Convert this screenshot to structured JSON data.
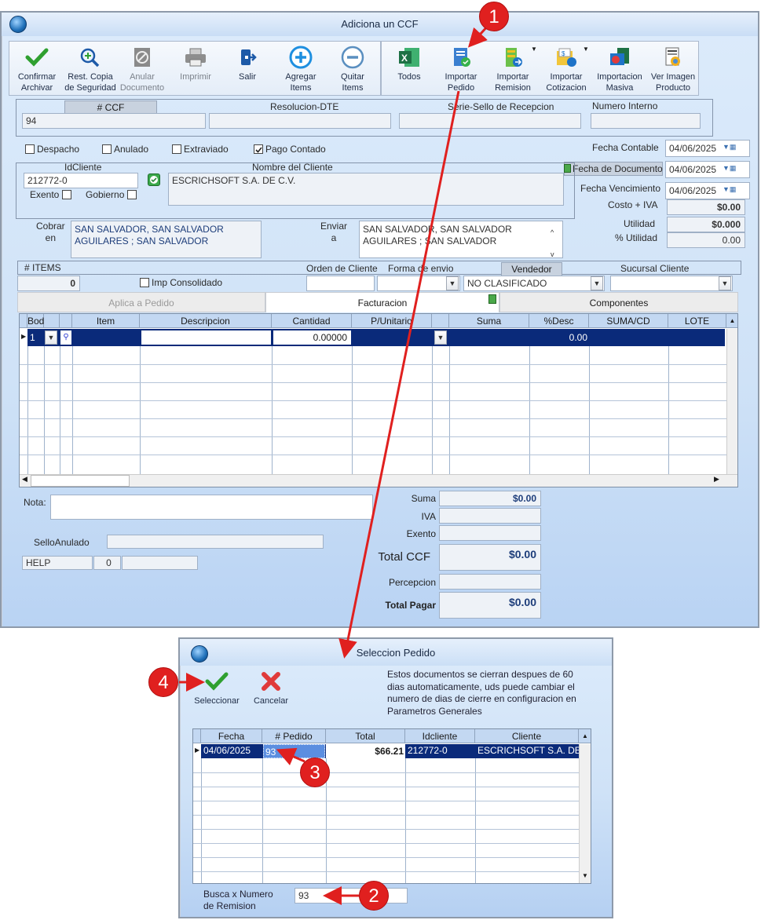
{
  "main_window": {
    "title": "Adiciona un CCF",
    "toolbar_left": [
      {
        "label": "Confirmar\nArchivar",
        "icon": "check-icon"
      },
      {
        "label": "Rest. Copia\nde Seguridad",
        "icon": "zoom-icon"
      },
      {
        "label": "Anular\nDocumento",
        "icon": "void-document-icon"
      },
      {
        "label": "Imprimir",
        "icon": "printer-icon"
      },
      {
        "label": "Salir",
        "icon": "exit-icon"
      },
      {
        "label": "Agregar\nItems",
        "icon": "plus-circle-icon"
      },
      {
        "label": "Quitar\nItems",
        "icon": "minus-circle-icon"
      }
    ],
    "toolbar_right": [
      {
        "label": "Todos",
        "icon": "excel-icon"
      },
      {
        "label": "Importar\nPedido",
        "icon": "import-order-icon"
      },
      {
        "label": "Importar\nRemision",
        "icon": "import-remission-icon"
      },
      {
        "label": "Importar\nCotizacion",
        "icon": "import-quote-icon"
      },
      {
        "label": "Importacion\nMasiva",
        "icon": "mass-import-icon"
      },
      {
        "label": "Ver Imagen\nProducto",
        "icon": "product-image-icon"
      }
    ],
    "header": {
      "ccf_label": "# CCF",
      "ccf_value": "94",
      "resolucion_label": "Resolucion-DTE",
      "resolucion_value": "",
      "serie_label": "Serie-Sello de Recepcion",
      "serie_value": "",
      "numero_label": "Numero Interno",
      "numero_value": ""
    },
    "flags": {
      "despacho": "Despacho",
      "anulado": "Anulado",
      "extraviado": "Extraviado",
      "pago_contado": "Pago Contado"
    },
    "dates": {
      "fecha_contable_label": "Fecha Contable",
      "fecha_contable": "04/06/2025",
      "fecha_documento_label": "Fecha de Documento",
      "fecha_documento": "04/06/2025",
      "fecha_vencimiento_label": "Fecha Vencimiento",
      "fecha_vencimiento": "04/06/2025"
    },
    "client": {
      "id_label": "IdCliente",
      "id_value": "212772-0",
      "nombre_label": "Nombre del Cliente",
      "nombre_value": "ESCRICHSOFT S.A. DE C.V.",
      "exento": "Exento",
      "gobierno": "Gobierno",
      "cobrar_label": "Cobrar\nen",
      "cobrar_value": "SAN SALVADOR, SAN SALVADOR\nAGUILARES ; SAN SALVADOR",
      "enviar_label": "Enviar\na",
      "enviar_value": "SAN SALVADOR, SAN SALVADOR\nAGUILARES ; SAN SALVADOR"
    },
    "costs": {
      "costo_iva_label": "Costo + IVA",
      "costo_iva": "$0.00",
      "utilidad_label": "Utilidad",
      "utilidad": "$0.000",
      "pct_utilidad_label": "% Utilidad",
      "pct_utilidad": "0.00"
    },
    "items_bar": {
      "items_label": "# ITEMS",
      "items_value": "0",
      "imp_consolidado": "Imp Consolidado",
      "orden_label": "Orden de Cliente",
      "forma_label": "Forma de envio",
      "vendedor_label": "Vendedor",
      "vendedor_value": "NO CLASIFICADO",
      "sucursal_label": "Sucursal Cliente"
    },
    "tabs": [
      "Aplica a Pedido",
      "Facturacion",
      "Componentes"
    ],
    "grid": {
      "columns": [
        "Bodega",
        "",
        "Item",
        "Descripcion",
        "Cantidad",
        "P/Unitario",
        "",
        "Suma",
        "%Desc",
        "SUMA/CD",
        "LOTE"
      ],
      "row": {
        "bodega": "1",
        "cantidad": "0.00000",
        "desc": "0.00"
      }
    },
    "footer": {
      "nota_label": "Nota:",
      "sello_label": "SelloAnulado",
      "help": "HELP",
      "help_num": "0",
      "suma_label": "Suma",
      "suma": "$0.00",
      "iva_label": "IVA",
      "exento_label": "Exento",
      "total_ccf_label": "Total CCF",
      "total_ccf": "$0.00",
      "percepcion_label": "Percepcion",
      "total_pagar_label": "Total Pagar",
      "total_pagar": "$0.00"
    }
  },
  "dialog": {
    "title": "Seleccion Pedido",
    "select_label": "Seleccionar",
    "cancel_label": "Cancelar",
    "note": "Estos documentos se cierran despues de 60\ndias automaticamente, uds puede cambiar el\nnumero de dias de cierre en configuracion en\nParametros Generales",
    "columns": [
      "Fecha",
      "# Pedido",
      "Total",
      "Idcliente",
      "Cliente"
    ],
    "row": {
      "fecha": "04/06/2025",
      "pedido": "93",
      "total": "$66.21",
      "idcliente": "212772-0",
      "cliente": "ESCRICHSOFT S.A. DE"
    },
    "search_label": "Busca x Numero\nde Remision",
    "search_value": "93"
  },
  "markers": [
    "1",
    "2",
    "3",
    "4"
  ],
  "colors": {
    "selection": "#0a2a7a",
    "marker": "#e0201f",
    "accent_blue": "#1e6fb8"
  }
}
